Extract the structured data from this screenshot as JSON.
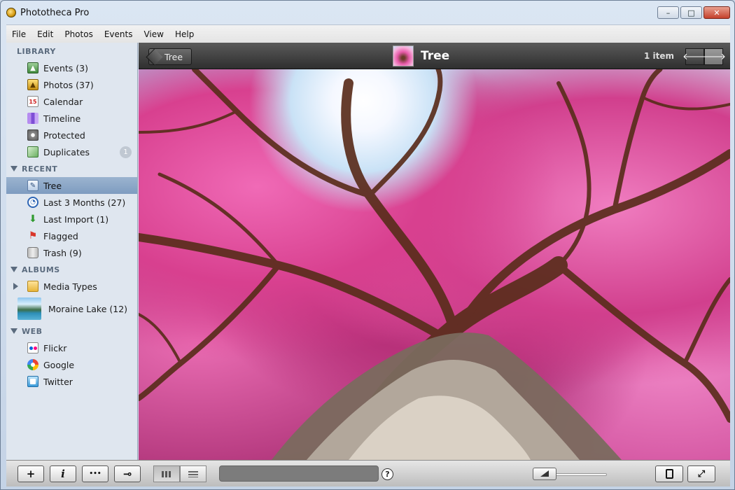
{
  "window": {
    "title": "Phototheca Pro",
    "controls": {
      "minimize": "–",
      "maximize": "□",
      "close": "✕"
    }
  },
  "menu": [
    "File",
    "Edit",
    "Photos",
    "Events",
    "View",
    "Help"
  ],
  "sidebar": {
    "library": {
      "header": "LIBRARY",
      "items": [
        {
          "label": "Events (3)",
          "icon": "events-icon"
        },
        {
          "label": "Photos (37)",
          "icon": "photos-icon"
        },
        {
          "label": "Calendar",
          "icon": "calendar-icon"
        },
        {
          "label": "Timeline",
          "icon": "timeline-icon"
        },
        {
          "label": "Protected",
          "icon": "protected-icon"
        },
        {
          "label": "Duplicates",
          "icon": "duplicates-icon",
          "badge": "1"
        }
      ]
    },
    "recent": {
      "header": "RECENT",
      "items": [
        {
          "label": "Tree",
          "icon": "smart-album-icon",
          "selected": true
        },
        {
          "label": "Last 3 Months (27)",
          "icon": "clock-icon"
        },
        {
          "label": "Last Import (1)",
          "icon": "import-icon"
        },
        {
          "label": "Flagged",
          "icon": "flag-icon"
        },
        {
          "label": "Trash (9)",
          "icon": "trash-icon"
        }
      ]
    },
    "albums": {
      "header": "ALBUMS",
      "items": [
        {
          "label": "Media Types",
          "icon": "folder-icon"
        },
        {
          "label": "Moraine Lake (12)",
          "icon": "album-thumbnail"
        }
      ]
    },
    "web": {
      "header": "WEB",
      "items": [
        {
          "label": "Flickr",
          "icon": "flickr-icon"
        },
        {
          "label": "Google",
          "icon": "google-icon"
        },
        {
          "label": "Twitter",
          "icon": "twitter-icon"
        }
      ]
    }
  },
  "content": {
    "back_label": "Tree",
    "title": "Tree",
    "item_count": "1 item",
    "prev_arrow": "🡐",
    "next_arrow": "🡒"
  },
  "toolbar": {
    "add": "+",
    "info": "i",
    "more": "•••",
    "key": "⊸",
    "help": "?",
    "slider_level": 0.15
  },
  "colors": {
    "selection": "#8aa6c8",
    "content_header": "#3d3d3d",
    "blossom_pink": "#e254a6"
  }
}
